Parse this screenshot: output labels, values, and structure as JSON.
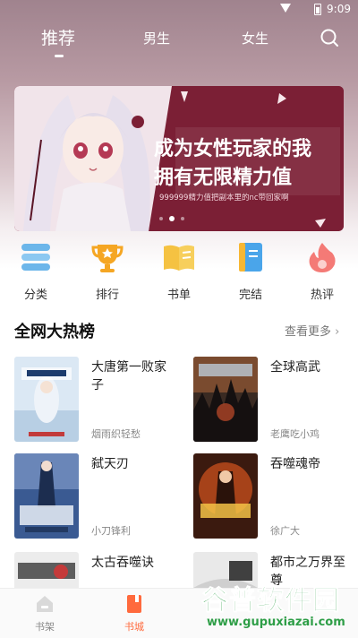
{
  "status": {
    "time": "9:09"
  },
  "nav": {
    "tabs": [
      "推荐",
      "男生",
      "女生"
    ]
  },
  "banner": {
    "title_line1": "成为女性玩家的我",
    "title_line2": "拥有无限精力值",
    "subtitle": "999999精力值把副本里的nc带回家啊"
  },
  "categories": [
    {
      "label": "分类",
      "icon": "category-icon"
    },
    {
      "label": "排行",
      "icon": "trophy-icon"
    },
    {
      "label": "书单",
      "icon": "book-list-icon"
    },
    {
      "label": "完结",
      "icon": "finished-book-icon"
    },
    {
      "label": "热评",
      "icon": "hot-comment-icon"
    }
  ],
  "section": {
    "title": "全网大热榜",
    "more": "查看更多"
  },
  "books": [
    {
      "title": "大唐第一败家子",
      "author": "烟雨织轻愁"
    },
    {
      "title": "全球高武",
      "author": "老鹰吃小鸡"
    },
    {
      "title": "弑天刃",
      "author": "小刀锋利"
    },
    {
      "title": "吞噬魂帝",
      "author": "徐广大"
    },
    {
      "title": "太古吞噬诀",
      "author": ""
    },
    {
      "title": "都市之万界至尊",
      "author": ""
    }
  ],
  "bottom_nav": [
    {
      "label": "书架",
      "icon": "bookshelf-icon"
    },
    {
      "label": "书城",
      "icon": "bookstore-icon"
    }
  ],
  "watermark": {
    "name": "谷普软件园",
    "url": "www.gupuxiazai.com"
  },
  "colors": {
    "accent": "#ff6a3d",
    "banner_bg": "#7b1f35",
    "watermark": "#2e9e47"
  }
}
